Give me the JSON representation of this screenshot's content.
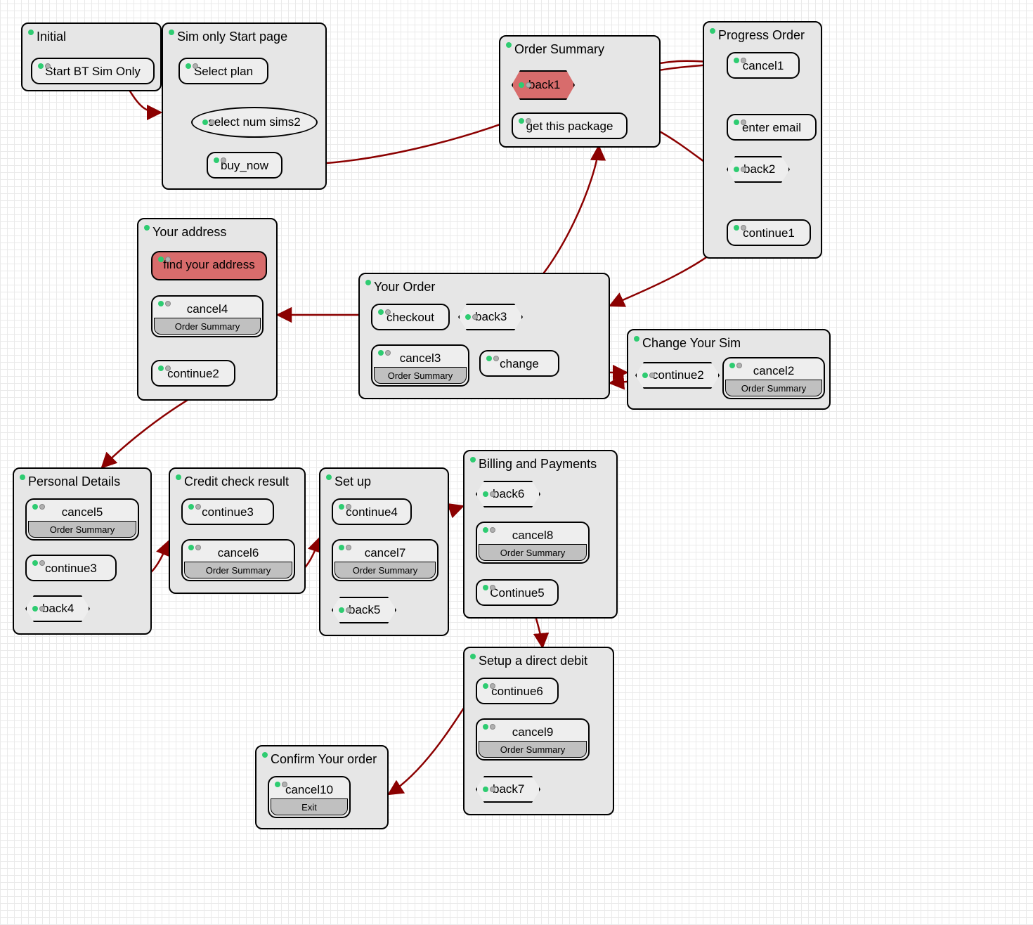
{
  "sublabels": {
    "order_summary": "Order Summary",
    "exit": "Exit"
  },
  "initial": {
    "title": "Initial",
    "start": "Start BT Sim Only"
  },
  "sim_start": {
    "title": "Sim only Start page",
    "select_plan": "Select plan",
    "select_num_sims": "select num sims2",
    "buy_now": "buy_now"
  },
  "order_summary": {
    "title": "Order Summary",
    "back1": "back1",
    "get_package": "get this package"
  },
  "progress_order": {
    "title": "Progress Order",
    "cancel1": "cancel1",
    "enter_email": "enter email",
    "back2": "back2",
    "continue1": "continue1"
  },
  "your_address": {
    "title": "Your address",
    "find": "find your address",
    "cancel4": "cancel4",
    "continue2": "continue2"
  },
  "your_order": {
    "title": "Your Order",
    "checkout": "checkout",
    "back3": "back3",
    "cancel3": "cancel3",
    "change": "change"
  },
  "change_sim": {
    "title": "Change Your Sim",
    "continue2": "continue2",
    "cancel2": "cancel2"
  },
  "personal_details": {
    "title": "Personal Details",
    "cancel5": "cancel5",
    "continue3": "continue3",
    "back4": "back4"
  },
  "credit_check": {
    "title": "Credit check result",
    "continue3": "continue3",
    "cancel6": "cancel6"
  },
  "set_up": {
    "title": "Set up",
    "continue4": "continue4",
    "cancel7": "cancel7",
    "back5": "back5"
  },
  "billing": {
    "title": "Billing and Payments",
    "back6": "back6",
    "cancel8": "cancel8",
    "continue5": "Continue5"
  },
  "direct_debit": {
    "title": "Setup a direct debit",
    "continue6": "continue6",
    "cancel9": "cancel9",
    "back7": "back7"
  },
  "confirm_order": {
    "title": "Confirm Your order",
    "cancel10": "cancel10"
  }
}
